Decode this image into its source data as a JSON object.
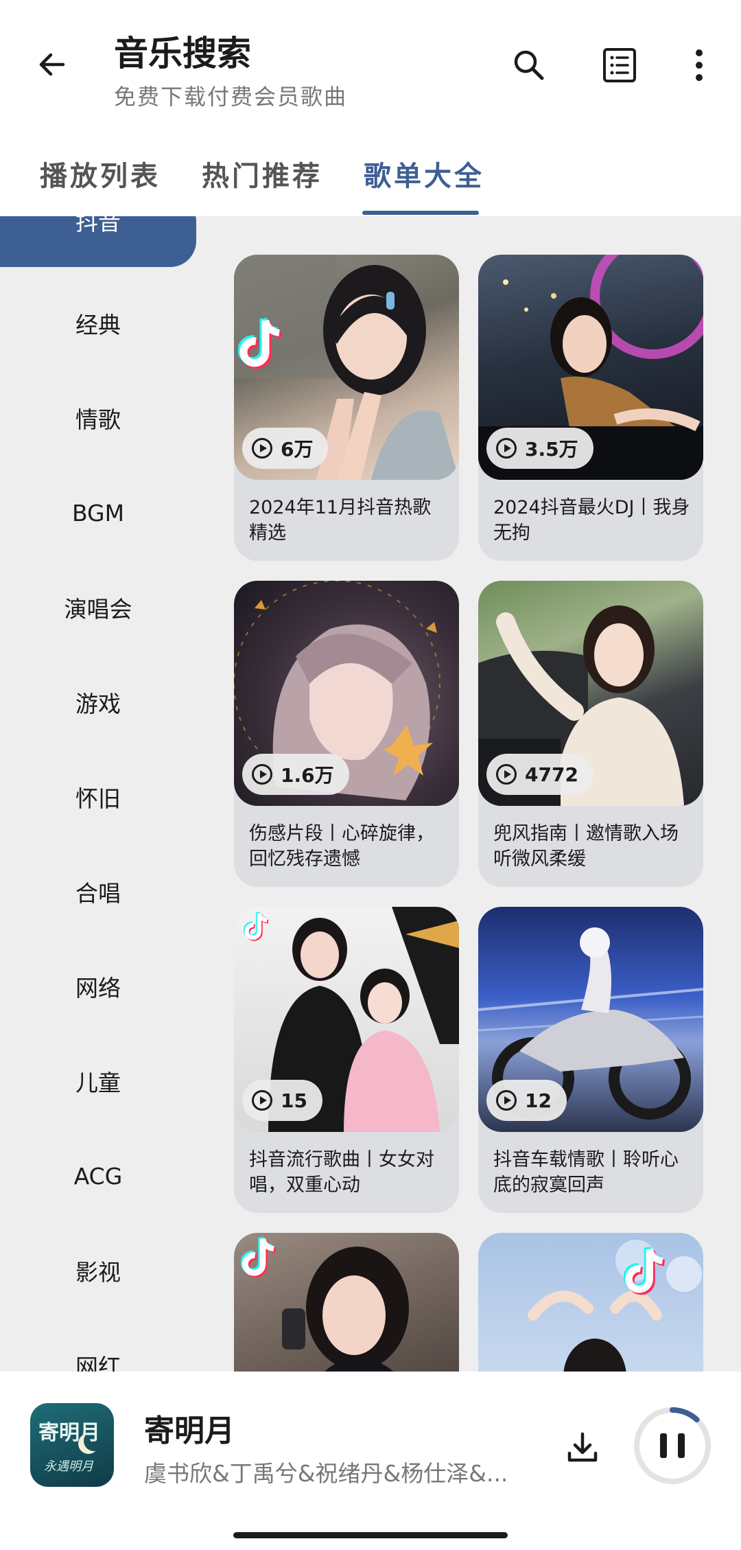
{
  "header": {
    "title": "音乐搜索",
    "subtitle": "免费下载付费会员歌曲",
    "icons": [
      "back-arrow-icon",
      "search-icon",
      "list-icon",
      "more-vertical-icon"
    ]
  },
  "tabs": [
    {
      "label": "播放列表",
      "active": false
    },
    {
      "label": "热门推荐",
      "active": false
    },
    {
      "label": "歌单大全",
      "active": true
    }
  ],
  "categories": [
    "抖音",
    "经典",
    "情歌",
    "BGM",
    "演唱会",
    "游戏",
    "怀旧",
    "合唱",
    "网络",
    "儿童",
    "ACG",
    "影视",
    "网红"
  ],
  "active_category": "抖音",
  "playlists": [
    {
      "plays": "6万",
      "name": "2024年11月抖音热歌精选"
    },
    {
      "plays": "3.5万",
      "name": "2024抖音最火DJ丨我身无拘"
    },
    {
      "plays": "1.6万",
      "name": "伤感片段丨心碎旋律，回忆残存遗憾"
    },
    {
      "plays": "4772",
      "name": "兜风指南丨邀情歌入场听微风柔缓"
    },
    {
      "plays": "15",
      "name": "抖音流行歌曲丨女女对唱，双重心动"
    },
    {
      "plays": "12",
      "name": "抖音车载情歌丨聆听心底的寂寞回声"
    },
    {
      "plays": "",
      "name": ""
    },
    {
      "plays": "",
      "name": ""
    }
  ],
  "player": {
    "cover_text": "寄明月",
    "cover_script": "永遇明月",
    "title": "寄明月",
    "artist": "虞书欣&丁禹兮&祝绪丹&杨仕泽&...",
    "progress": 0.12,
    "state": "playing"
  },
  "colors": {
    "accent": "#3d5f93",
    "content_bg": "#eeeeee",
    "card_bg": "#dcdee2"
  }
}
